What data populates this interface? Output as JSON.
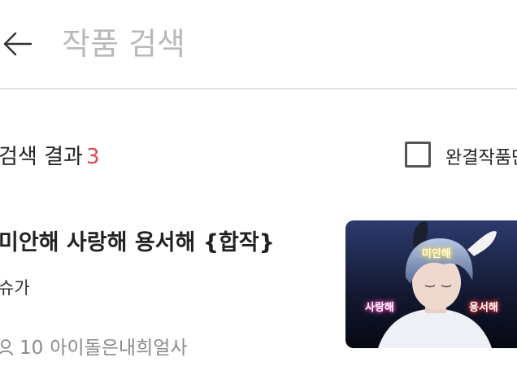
{
  "header": {
    "back_icon": "arrow-left-icon",
    "search_placeholder": "작품 검색",
    "search_value": ""
  },
  "results": {
    "label": "검색 결과",
    "count": "3",
    "count_color": "#e0474c"
  },
  "filter": {
    "completed_label": "완결작품만",
    "checked": false
  },
  "works": [
    {
      "title": "미안해 사랑해 용서해 {합작}",
      "author": "슈가",
      "author_icon": "person-icon",
      "member_count": "10",
      "member_label": "아이돌은내희얼사",
      "thumbnail_labels": [
        "미안해",
        "사랑해",
        "용서해"
      ]
    }
  ]
}
